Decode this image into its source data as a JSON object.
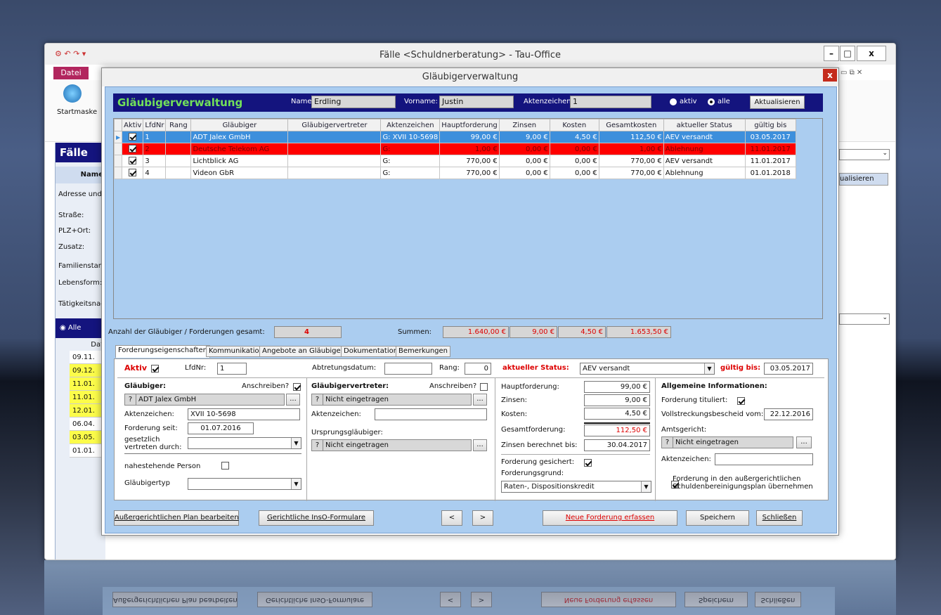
{
  "outer": {
    "title": "Fälle <Schuldnerberatung> - Tau-Office",
    "file_tab": "Datei",
    "startmaske": "Startmaske",
    "faelle_title": "Fälle",
    "name_col": "Name",
    "adresse": "Adresse und r",
    "strasse": "Straße:",
    "plz": "PLZ+Ort:",
    "zusatz": "Zusatz:",
    "familienstand": "Familienstand",
    "lebensform": "Lebensform:",
    "taetigkeit": "Tätigkeitsnach",
    "alle": "Alle",
    "dat_col": "Dat",
    "dates": [
      "09.11.",
      "09.12.",
      "11.01.",
      "11.01.",
      "12.01.",
      "06.04.",
      "03.05.",
      "01.01."
    ],
    "right_btn": "ualisieren"
  },
  "dialog": {
    "title": "Gläubigerverwaltung",
    "close": "x"
  },
  "header": {
    "title": "Gläubigerverwaltung",
    "name_label": "Name",
    "name_value": "Erdling",
    "vorname_label": "Vorname:",
    "vorname_value": "Justin",
    "az_label": "Aktenzeichen:",
    "az_value": "1",
    "aktiv": "aktiv",
    "alle": "alle",
    "refresh": "Aktualisieren"
  },
  "grid": {
    "columns": [
      "Aktiv",
      "LfdNr",
      "Rang",
      "Gläubiger",
      "Gläubigervertreter",
      "Aktenzeichen",
      "Hauptforderung",
      "Zinsen",
      "Kosten",
      "Gesamtkosten",
      "aktueller Status",
      "gültig bis"
    ],
    "rows": [
      {
        "lfd": "1",
        "rang": "",
        "glaeubiger": "ADT Jalex GmbH",
        "vertreter": "",
        "az": "G: XVII 10-5698",
        "haupt": "99,00 €",
        "zinsen": "9,00 €",
        "kosten": "4,50 €",
        "gesamt": "112,50 €",
        "status": "AEV versandt",
        "gueltig": "03.05.2017"
      },
      {
        "lfd": "2",
        "rang": "",
        "glaeubiger": "Deutsche Telekom AG",
        "vertreter": "",
        "az": "G:",
        "haupt": "1,00 €",
        "zinsen": "0,00 €",
        "kosten": "0,00 €",
        "gesamt": "1,00 €",
        "status": "Ablehnung",
        "gueltig": "11.01.2017"
      },
      {
        "lfd": "3",
        "rang": "",
        "glaeubiger": "Lichtblick AG",
        "vertreter": "",
        "az": "G:",
        "haupt": "770,00 €",
        "zinsen": "0,00 €",
        "kosten": "0,00 €",
        "gesamt": "770,00 €",
        "status": "AEV versandt",
        "gueltig": "11.01.2017"
      },
      {
        "lfd": "4",
        "rang": "",
        "glaeubiger": "Videon GbR",
        "vertreter": "",
        "az": "G:",
        "haupt": "770,00 €",
        "zinsen": "0,00 €",
        "kosten": "0,00 €",
        "gesamt": "770,00 €",
        "status": "Ablehnung",
        "gueltig": "01.01.2018"
      }
    ]
  },
  "summary": {
    "count_label": "Anzahl der Gläubiger / Forderungen gesamt:",
    "count": "4",
    "sum_label": "Summen:",
    "haupt": "1.640,00 €",
    "zinsen": "9,00 €",
    "kosten": "4,50 €",
    "gesamt": "1.653,50 €"
  },
  "tabs": [
    "Forderungseigenschaften",
    "Kommunikation",
    "Angebote an Gläubiger",
    "Dokumentation",
    "Bemerkungen"
  ],
  "form": {
    "aktiv": "Aktiv",
    "lfdnr_label": "LfdNr:",
    "lfdnr": "1",
    "abtretung_label": "Abtretungsdatum:",
    "abtretung": "",
    "rang_label": "Rang:",
    "rang": "0",
    "glaeubiger_label": "Gläubiger:",
    "anschreiben": "Anschreiben?",
    "glaeubiger_q": "?",
    "glaeubiger": "ADT Jalex GmbH",
    "az_label": "Aktenzeichen:",
    "az": "XVII 10-5698",
    "seit_label": "Forderung seit:",
    "seit": "01.07.2016",
    "gesetzlich": "gesetzlich",
    "vertreten": "vertreten durch:",
    "nahestehend": "nahestehende Person",
    "typ": "Gläubigertyp",
    "vertreter_label": "Gläubigervertreter:",
    "vertreter": "Nicht eingetragen",
    "vertreter_az_label": "Aktenzeichen:",
    "ursprung_label": "Ursprungsgläubiger:",
    "ursprung": "Nicht eingetragen",
    "status_label": "aktueller Status:",
    "status": "AEV versandt",
    "gueltig_label": "gültig bis:",
    "gueltig": "03.05.2017",
    "haupt_label": "Hauptforderung:",
    "haupt": "99,00 €",
    "zinsen_label": "Zinsen:",
    "zinsen": "9,00 €",
    "kosten_label": "Kosten:",
    "kosten": "4,50 €",
    "gesamt_label": "Gesamtforderung:",
    "gesamt": "112,50 €",
    "zinsen_bis_label": "Zinsen berechnet bis:",
    "zinsen_bis": "30.04.2017",
    "gesichert": "Forderung  gesichert:",
    "grund_label": "Forderungsgrund:",
    "grund": "Raten-, Dispositionskredit",
    "allg": "Allgemeine Informationen:",
    "tituliert": "Forderung tituliert:",
    "vollstr_label": "Vollstreckungsbescheid vom:",
    "vollstr": "22.12.2016",
    "amtsgericht": "Amtsgericht:",
    "amtsgericht_val": "Nicht eingetragen",
    "ag_az": "Aktenzeichen:",
    "plan_line1": "Forderung in den außergerichtlichen",
    "plan_line2": "Schuldenbereinigungsplan übernehmen",
    "dots": "..."
  },
  "buttons": {
    "plan": "Außergerichtlichen Plan bearbeiten",
    "inso": "Gerichtliche InsO-Formulare",
    "prev": "<",
    "next": ">",
    "neu": "Neue Forderung erfassen",
    "save": "Speichern",
    "close": "Schließen"
  }
}
